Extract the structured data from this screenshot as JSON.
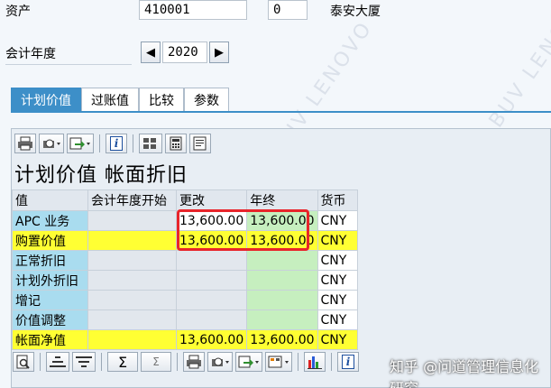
{
  "header": {
    "asset_label": "资产",
    "asset_number": "410001",
    "sub_number": "0",
    "asset_description": "泰安大厦",
    "fiscal_year_label": "会计年度",
    "fiscal_year": "2020",
    "prev_year": "◀",
    "next_year": "▶"
  },
  "tabs": [
    {
      "label": "计划价值",
      "active": true
    },
    {
      "label": "过账值",
      "active": false
    },
    {
      "label": "比较",
      "active": false
    },
    {
      "label": "参数",
      "active": false
    }
  ],
  "panel": {
    "title": "计划价值 帐面折旧",
    "columns": [
      "值",
      "会计年度开始",
      "更改",
      "年终",
      "货币"
    ],
    "rows": [
      {
        "label": "APC 业务",
        "start": "",
        "change": "13,600.00",
        "year_end": "13,600.00",
        "currency": "CNY"
      },
      {
        "label": "购置价值",
        "start": "",
        "change": "13,600.00",
        "year_end": "13,600.00",
        "currency": "CNY"
      },
      {
        "label": "正常折旧",
        "start": "",
        "change": "",
        "year_end": "",
        "currency": "CNY"
      },
      {
        "label": "计划外折旧",
        "start": "",
        "change": "",
        "year_end": "",
        "currency": "CNY"
      },
      {
        "label": "增记",
        "start": "",
        "change": "",
        "year_end": "",
        "currency": "CNY"
      },
      {
        "label": "价值调整",
        "start": "",
        "change": "",
        "year_end": "",
        "currency": "CNY"
      },
      {
        "label": "帐面净值",
        "start": "",
        "change": "13,600.00",
        "year_end": "13,600.00",
        "currency": "CNY"
      }
    ]
  },
  "toolbar_icons": [
    "print-icon",
    "print-preview-icon",
    "export-icon",
    "info-icon",
    "layout-icon",
    "calculator-icon",
    "notes-icon"
  ],
  "bottom_toolbar": {
    "sum_glyph": "Σ",
    "info_glyph": "i"
  },
  "watermark": {
    "text": "知乎 @问道管理信息化研究",
    "background": "LAPTOP-KCMDLBUV LENOVO"
  },
  "colors": {
    "tab_active": "#3d8fc8",
    "highlight_yellow": "#ffff33",
    "label_blue": "#a9dcef",
    "result_green": "#c6efbf",
    "annotation_red": "#e8242a"
  }
}
